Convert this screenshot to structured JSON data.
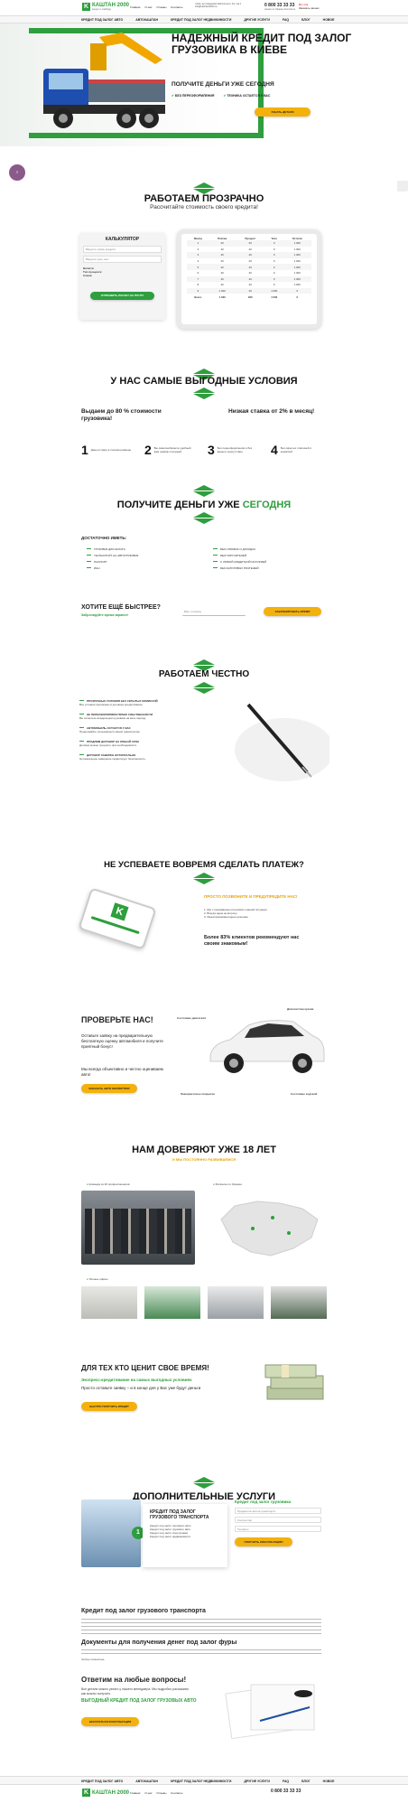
{
  "header": {
    "logo_name": "КАШТАН 2000",
    "logo_sub": "кредит и ломбард",
    "contacts_1": "г.Київ, вул.Академіка Заболотного, 2/1, оф.1",
    "contacts_2": "info@kashtan2000.ua",
    "phone": "0 800 33 33 33",
    "phone_note": "звонки по Украине бесплатно",
    "lang": "Ru | Ua",
    "callback": "Заказать звонок",
    "nav": [
      "КРЕДИТ ПОД ЗАЛОГ АВТО",
      "АВТОКАШТАН",
      "КРЕДИТ ПОД ЗАЛОГ НЕДВИЖИМОСТИ",
      "ДРУГИЕ УСЛУГИ",
      "FAQ",
      "БЛОГ",
      "НОВОЕ"
    ],
    "top_links": [
      "Главная",
      "О нас",
      "Отзывы",
      "Контакты"
    ]
  },
  "hero": {
    "title": "НАДЕЖНЫЙ КРЕДИТ ПОД ЗАЛОГ ГРУЗОВИКА В КИЕВЕ",
    "subtitle": "Получите деньги уже сегодня",
    "badge1": "БЕЗ ПЕРЕОФОРМЛЕНИЯ",
    "badge2": "ТЕХНИКА ОСТАЕТСЯ У ВАС",
    "cta": "УЗНАТЬ ДЕТАЛИ"
  },
  "transparent": {
    "title": "РАБОТАЕМ ПРОЗРАЧНО",
    "subtitle": "Рассчитайте стоимость своего кредита!",
    "calc_title": "КАЛЬКУЛЯТОР",
    "fields": [
      "Введите сумму кредита",
      "Введите срок, мес"
    ],
    "options": [
      "Валюта:",
      "Тип процента:",
      "Схема:"
    ],
    "calc_btn": "ОТПРАВИТЬ РАСЧЕТ НА ПОЧТУ",
    "table_head": [
      "Месяц",
      "Платеж",
      "Процент",
      "Тело",
      "Остаток"
    ],
    "table_rows": [
      [
        "1",
        "20",
        "20",
        "0",
        "1 000"
      ],
      [
        "2",
        "20",
        "20",
        "0",
        "1 000"
      ],
      [
        "3",
        "20",
        "20",
        "0",
        "1 000"
      ],
      [
        "4",
        "20",
        "20",
        "0",
        "1 000"
      ],
      [
        "5",
        "20",
        "20",
        "0",
        "1 000"
      ],
      [
        "6",
        "20",
        "20",
        "0",
        "1 000"
      ],
      [
        "7",
        "20",
        "20",
        "0",
        "1 000"
      ],
      [
        "8",
        "20",
        "20",
        "0",
        "1 000"
      ],
      [
        "9",
        "1 020",
        "20",
        "1 000",
        "0"
      ],
      [
        "Всего",
        "1 180",
        "180",
        "1 000",
        "0"
      ]
    ]
  },
  "conditions": {
    "title": "У НАС САМЫЕ ВЫГОДНЫЕ УСЛОВИЯ",
    "left": "Выдаем до 80 % стоимости грузовика!",
    "right": "Низкая ставка от 2% в месяц!",
    "steps": [
      {
        "n": "1",
        "t": "Деньги сразу в полном размере"
      },
      {
        "n": "2",
        "t": "Вы сами выбираете удобный вам график платежей"
      },
      {
        "n": "3",
        "t": "Без переоформления и без вашего присутствия"
      },
      {
        "n": "4",
        "t": "Без скрытых платежей и комиссий"
      }
    ]
  },
  "docs": {
    "title_a": "ПОЛУЧИТЕ ДЕНЬГИ УЖЕ",
    "title_b": "СЕГОДНЯ",
    "need": "ДОСТАТОЧНО ИМЕТЬ:",
    "left": [
      "ГРУЗОВИК ДЛЯ ЗАЛОГА",
      "ТЕХПАСПОРТ НА АВТОГРУЗОВИК",
      "ПАСПОРТ",
      "ИНН"
    ],
    "right": [
      "БЕЗ СПРАВОК О ДОХОДАХ",
      "БЕЗ ПОРУЧИТЕЛЕЙ",
      "С ЛЮБОЙ КРЕДИТНОЙ ИСТОРИЕЙ",
      "БЕЗ ЗАЛОГОВЫХ ПЛАТЕЖЕЙ"
    ],
    "faster": "ХОТИТЕ ЕЩЁ БЫСТРЕЕ?",
    "faster_sub": "Забронируйте время заранее!",
    "phone_ph": "Ваш телефон",
    "book_btn": "ЗАБРОНИРОВАТЬ ВРЕМЯ"
  },
  "honest": {
    "title": "РАБОТАЕМ ЧЕСТНО",
    "items": [
      {
        "h": "ПРОЗРАЧНЫЕ УСЛОВИЯ БЕЗ СКРЫТЫХ КОМИССИЙ",
        "t": "Все условия прописаны в договоре кредитования."
      },
      {
        "h": "НЕ ПЕРЕОФОРМЛЯЕМ ПРАВО СОБСТВЕННОСТИ",
        "t": "Вы остаетесь владельцем грузовика на весь период."
      },
      {
        "h": "АВТОМОБИЛЬ ОСТАЕТСЯ У ВАС",
        "t": "Продолжайте пользоваться своим транспортом."
      },
      {
        "h": "ПРОДЛИМ ДОГОВОР НА ЛЮБОЙ СРОК",
        "t": "Договор можно продлить при необходимости."
      },
      {
        "h": "ДОГОВОР ЗАВЕРЕН НОТАРИАЛЬНО",
        "t": "Нотариальное заверение гарантирует безопасность."
      }
    ]
  },
  "late": {
    "title": "НЕ УСПЕВАЕТЕ ВОВРЕМЯ СДЕЛАТЬ ПЛАТЕЖ?",
    "head": "ПРОСТО ПОЗВОНИТЕ И ПРЕДУПРЕДИТЕ НАС!",
    "list": [
      "1. Мы с пониманием относимся к вашей ситуации",
      "2. Всегда идем на встречу",
      "3. Ищем взаимовыгодное решение"
    ],
    "stat": "Более 83% клиентов рекомендуют нас своим знакомым!"
  },
  "check": {
    "title": "ПРОВЕРЬТЕ НАС!",
    "text1": "Оставьте заявку на предварительную бесплатную оценку автомобиля и получите приятный бонус!",
    "text2": "Мы всегда объективно и честно оцениваем авто!",
    "btn": "ЗАКАЗАТЬ АВТО ЭКСПЕРТИЗУ",
    "labels": [
      "Состояние двигателя",
      "Диагностика кузова",
      "Лакокрасочное покрытие",
      "Состояние ходовой"
    ]
  },
  "trust": {
    "title": "НАМ ДОВЕРЯЮТ УЖЕ 18 ЛЕТ",
    "sub": "И МЫ ПОСТОЯННО РАЗВИВАЕМСЯ",
    "team": "Команда из 26 профессионалов",
    "branches": "Филиалы по Украине",
    "offices": "Личные офисы"
  },
  "time": {
    "title": "ДЛЯ ТЕХ КТО ЦЕНИТ СВОЕ ВРЕМЯ!",
    "sub": "Экспресс-кредитование на самых выгодных условиях",
    "text": "Просто оставьте заявку – и в конце дня у Вас уже будут деньги",
    "btn": "БЫСТРО ПОЛУЧИТЬ КРЕДИТ"
  },
  "extra": {
    "title": "ДОПОЛНИТЕЛЬНЫЕ УСЛУГИ",
    "card_title": "КРЕДИТ ПОД ЗАЛОГ ГРУЗОВОГО ТРАНСПОРТА",
    "card_lines": [
      "Кредит под залог легкового авто",
      "Кредит под залог грузового авто",
      "Кредит под залог спецтехники",
      "Кредит под залог недвижимости"
    ],
    "form_title": "Кредит под залог грузовика",
    "form_fields": [
      "Предметов залога транспорта",
      "Количество",
      "Телефон"
    ],
    "form_btn": "ПОЛУЧИТЬ КОНСУЛЬТАЦИЮ"
  },
  "article": {
    "h1": "Кредит под залог грузового транспорта",
    "h2": "Документы для получения денег под залог фуры",
    "more": "Читать полностью"
  },
  "answer": {
    "title": "Ответим на любые вопросы!",
    "text": "Все детали можно узнать у нашего менеджера. Мы подробно расскажем как можно получить",
    "green": "ВЫГОДНЫЙ КРЕДИТ ПОД ЗАЛОГ ГРУЗОВЫХ АВТО",
    "btn": "БЕСПЛАТНАЯ КОНСУЛЬТАЦИЯ"
  },
  "footer": {
    "nav": [
      "КРЕДИТ ПОД ЗАЛОГ АВТО",
      "АВТОКАШТАН",
      "КРЕДИТ ПОД ЗАЛОГ НЕДВИЖИМОСТИ",
      "ДРУГИЕ УСЛУГИ",
      "FAQ",
      "БЛОГ",
      "НОВОЕ"
    ],
    "links": [
      "Главная",
      "О нас",
      "Отзывы",
      "Контакты"
    ],
    "phone": "0 800 33 33 33"
  },
  "colors": {
    "green": "#2e9e3e",
    "yellow": "#f3b10d"
  }
}
